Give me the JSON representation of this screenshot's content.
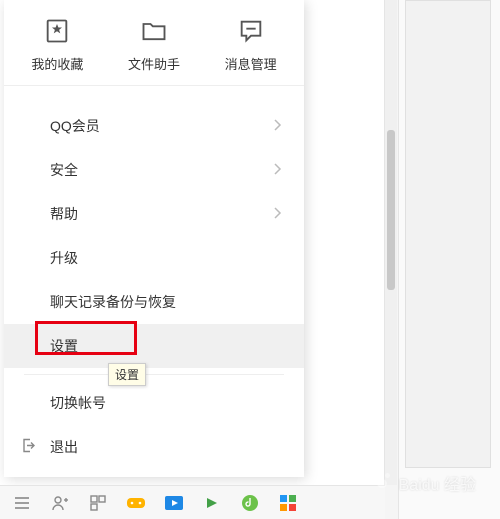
{
  "topActions": {
    "favorites": "我的收藏",
    "fileHelper": "文件助手",
    "msgManage": "消息管理"
  },
  "menu": {
    "qqMember": "QQ会员",
    "security": "安全",
    "help": "帮助",
    "upgrade": "升级",
    "chatBackup": "聊天记录备份与恢复",
    "settings": "设置",
    "switchAcct": "切换帐号",
    "exit": "退出"
  },
  "tooltip": "设置",
  "watermark": "Baidu 经验"
}
